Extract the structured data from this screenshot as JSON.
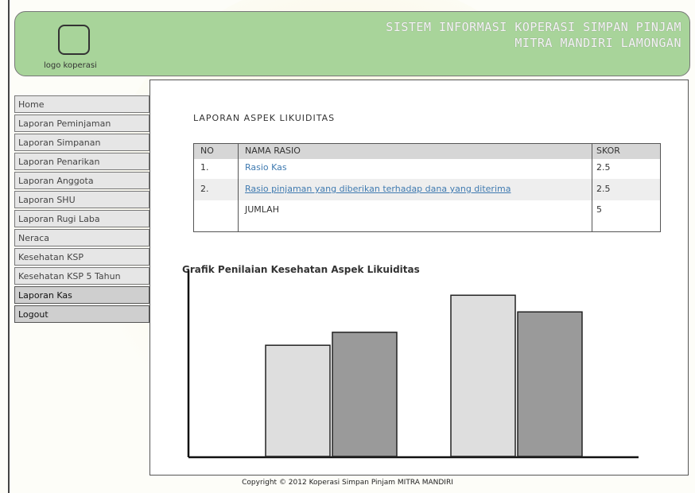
{
  "header": {
    "logo_caption": "logo koperasi",
    "title_line1": "SISTEM INFORMASI KOPERASI SIMPAN PINJAM",
    "title_line2": "MITRA MANDIRI LAMONGAN"
  },
  "sidebar": {
    "items": [
      {
        "label": "Home"
      },
      {
        "label": "Laporan Peminjaman"
      },
      {
        "label": "Laporan Simpanan"
      },
      {
        "label": "Laporan Penarikan"
      },
      {
        "label": "Laporan Anggota"
      },
      {
        "label": "Laporan SHU"
      },
      {
        "label": "Laporan Rugi Laba"
      },
      {
        "label": "Neraca"
      },
      {
        "label": "Kesehatan KSP"
      },
      {
        "label": "Kesehatan KSP 5 Tahun"
      },
      {
        "label": "Laporan Kas"
      },
      {
        "label": "Logout"
      }
    ]
  },
  "report": {
    "title": "LAPORAN ASPEK LIKUIDITAS",
    "columns": [
      "NO",
      "NAMA RASIO",
      "SKOR"
    ],
    "rows": [
      {
        "no": "1.",
        "name": "Rasio Kas",
        "score": "2.5"
      },
      {
        "no": "2.",
        "name": "Rasio pinjaman yang diberikan terhadap dana yang diterima",
        "score": "2.5"
      },
      {
        "no": "",
        "name": "JUMLAH",
        "score": "5"
      }
    ]
  },
  "chart_title": "Grafik Penilaian Kesehatan Aspek Likuiditas",
  "chart_data": {
    "type": "bar",
    "categories": [
      "",
      ""
    ],
    "series": [
      {
        "values": [
          60,
          87
        ],
        "color": "#dedede"
      },
      {
        "values": [
          67,
          78
        ],
        "color": "#9a9a9a"
      }
    ],
    "ylim": [
      0,
      100
    ],
    "grid": false
  },
  "footer": {
    "copyright": "Copyright © 2012 Koperasi Simpan Pinjam MITRA MANDIRI"
  }
}
